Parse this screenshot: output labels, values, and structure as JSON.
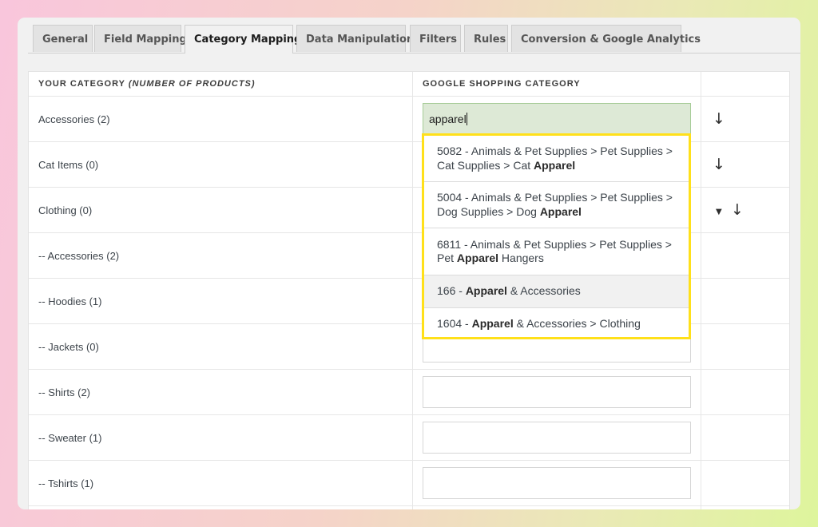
{
  "tabs": [
    {
      "label": "General",
      "active": false
    },
    {
      "label": "Field Mapping",
      "active": false
    },
    {
      "label": "Category Mapping",
      "active": true
    },
    {
      "label": "Data Manipulation",
      "active": false
    },
    {
      "label": "Filters",
      "active": false
    },
    {
      "label": "Rules",
      "active": false
    },
    {
      "label": "Conversion & Google Analytics",
      "active": false
    }
  ],
  "table": {
    "header_category_prefix": "YOUR CATEGORY",
    "header_category_emph": "(NUMBER OF PRODUCTS)",
    "header_google": "GOOGLE SHOPPING CATEGORY",
    "rows": [
      {
        "category": "Accessories (2)",
        "value": "apparel"
      },
      {
        "category": "Cat Items (0)",
        "value": ""
      },
      {
        "category": "Clothing (0)",
        "value": ""
      },
      {
        "category": "-- Accessories (2)",
        "value": ""
      },
      {
        "category": "-- Hoodies (1)",
        "value": ""
      },
      {
        "category": "-- Jackets (0)",
        "value": ""
      },
      {
        "category": "-- Shirts (2)",
        "value": ""
      },
      {
        "category": "-- Sweater (1)",
        "value": ""
      },
      {
        "category": "-- Tshirts (1)",
        "value": ""
      }
    ]
  },
  "icons": {
    "copy_down": "arrow-down-icon",
    "expand": "caret-down-icon"
  },
  "autocomplete": {
    "query": "apparel",
    "highlight_color": "#ffe01a",
    "options": [
      {
        "pre": "5082 - Animals & Pet Supplies > Pet Supplies > Cat Supplies > Cat ",
        "match": "Apparel",
        "post": ""
      },
      {
        "pre": "5004 - Animals & Pet Supplies > Pet Supplies > Dog Supplies > Dog ",
        "match": "Apparel",
        "post": ""
      },
      {
        "pre": "6811 - Animals & Pet Supplies > Pet Supplies > Pet ",
        "match": "Apparel",
        "post": " Hangers"
      },
      {
        "pre": "166 - ",
        "match": "Apparel",
        "post": " & Accessories"
      },
      {
        "pre": "1604 - ",
        "match": "Apparel",
        "post": " & Accessories > Clothing"
      }
    ]
  }
}
